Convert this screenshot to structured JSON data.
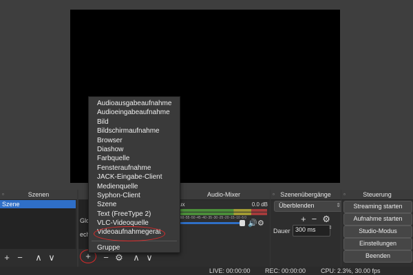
{
  "docks": {
    "scenes": {
      "title": "Szenen",
      "items": [
        "Szene"
      ]
    },
    "sources": {
      "visible_fragments": [
        "Glo",
        "ech"
      ]
    },
    "mixer": {
      "title": "Audio-Mixer",
      "channel_name": "ux",
      "level": "0.0 dB",
      "ticks": [
        "-60",
        "-55",
        "-50",
        "-45",
        "-40",
        "-35",
        "-30",
        "-25",
        "-20",
        "-15",
        "-10",
        "-5",
        "0"
      ]
    },
    "transitions": {
      "title": "Szenenübergänge",
      "selected": "Überblenden",
      "duration_label": "Dauer",
      "duration_value": "300 ms"
    },
    "controls": {
      "title": "Steuerung",
      "buttons": [
        "Streaming starten",
        "Aufnahme starten",
        "Studio-Modus",
        "Einstellungen",
        "Beenden"
      ]
    }
  },
  "toolbar_glyphs": {
    "add": "+",
    "remove": "−",
    "up": "∧",
    "down": "∨"
  },
  "context_menu": {
    "items": [
      "Audioausgabeaufnahme",
      "Audioeingabeaufnahme",
      "Bild",
      "Bildschirmaufnahme",
      "Browser",
      "Diashow",
      "Farbquelle",
      "Fensteraufnahme",
      "JACK-Eingabe-Client",
      "Medienquelle",
      "Syphon-Client",
      "Szene",
      "Text (FreeType 2)",
      "VLC-Videoquelle",
      "Videoaufnahmegerät"
    ],
    "group_item": "Gruppe",
    "highlighted": "Videoaufnahmegerät"
  },
  "status": {
    "live": "LIVE: 00:00:00",
    "rec": "REC: 00:00:00",
    "cpu": "CPU: 2.3%, 30.00 fps"
  },
  "colors": {
    "accent": "#2f6fc7",
    "annotation": "#e02a2a",
    "preview": "#000000"
  }
}
